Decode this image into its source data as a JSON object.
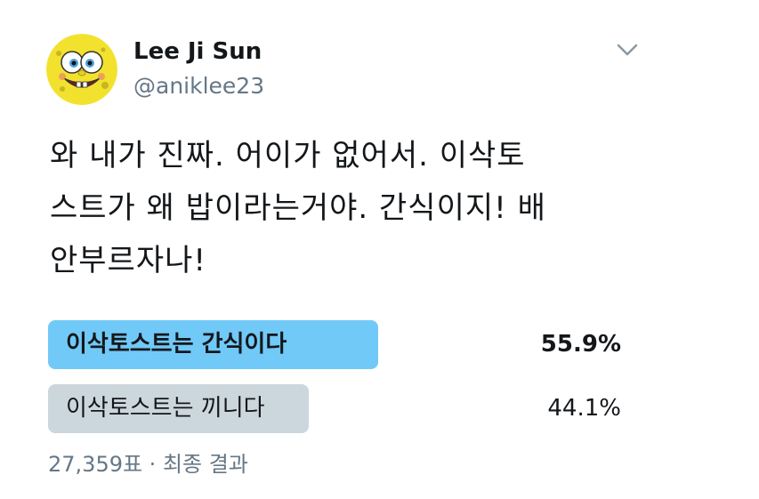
{
  "author": {
    "name": "Lee Ji Sun",
    "handle": "@aniklee23",
    "avatar_icon": "spongebob-avatar-icon"
  },
  "menu_icon": "chevron-down-icon",
  "tweet": {
    "lines": [
      "와 내가 진짜. 어이가 없어서. 이삭토",
      "스트가 왜 밥이라는거야. 간식이지! 배",
      "안부르자나!"
    ]
  },
  "poll": {
    "options": [
      {
        "label": "이삭토스트는 간식이다",
        "percent_text": "55.9%",
        "percent": 55.9,
        "color": "#71c9f8",
        "winner": true
      },
      {
        "label": "이삭토스트는 끼니다",
        "percent_text": "44.1%",
        "percent": 44.1,
        "color": "#ccd6dd",
        "winner": false
      }
    ],
    "footer": "27,359표 · 최종 결과"
  },
  "colors": {
    "text": "#14171a",
    "secondary": "#657786",
    "winner_bar": "#71c9f8",
    "other_bar": "#ccd6dd"
  }
}
